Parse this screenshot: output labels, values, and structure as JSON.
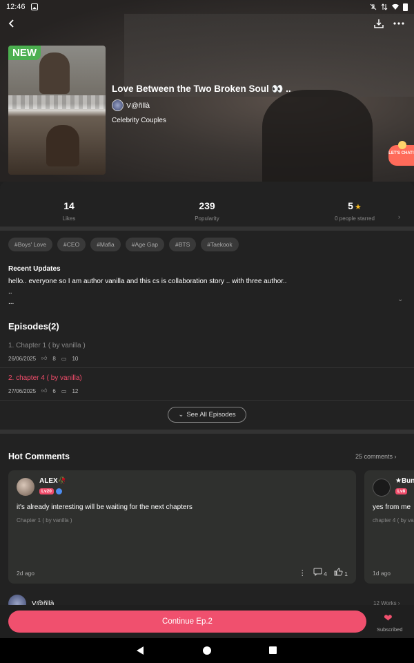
{
  "status_bar": {
    "time": "12:46",
    "icons": [
      "image-icon",
      "mute-icon",
      "data-icon",
      "wifi-icon",
      "battery-icon"
    ]
  },
  "header": {
    "back_icon": "back-arrow-icon",
    "download_icon": "download-icon",
    "more_icon": "more-icon"
  },
  "story": {
    "badge": "NEW",
    "title": "Love Between the Two Broken Soul 👀 ..",
    "author": "V@ñllà",
    "genre": "Celebrity Couples",
    "chat_badge": "LET'S CHAT!"
  },
  "stats": {
    "likes_value": "14",
    "likes_label": "Likes",
    "popularity_value": "239",
    "popularity_label": "Popularity",
    "rating_value": "5",
    "rating_label": "0 people starred"
  },
  "tags": [
    "#Boys' Love",
    "#CEO",
    "#Mafia",
    "#Age Gap",
    "#BTS",
    "#Taekook"
  ],
  "recent_updates": {
    "title": "Recent Updates",
    "text": "hello.. everyone so I am author vanilla and this cs is collaboration story .. with three author..\n..\n..."
  },
  "episodes": {
    "header": "Episodes(2)",
    "items": [
      {
        "title": "1. Chapter 1 ( by vanilla )",
        "date": "26/06/2025",
        "likes": "8",
        "comments": "10"
      },
      {
        "title": "2. chapter 4 ( by vanilla)",
        "date": "27/06/2025",
        "likes": "6",
        "comments": "12"
      }
    ],
    "see_all": "See All Episodes"
  },
  "hot_comments": {
    "header": "Hot Comments",
    "count": "25 comments",
    "comments": [
      {
        "name": "ALEX🥀",
        "level": "Lv20",
        "text": "it's already interesting will be waiting for the next chapters",
        "chapter": "Chapter 1 ( by vanilla )",
        "time": "2d ago",
        "replies": "4",
        "likes": "1"
      },
      {
        "name": "★Bun",
        "level": "Lv8",
        "text": "yes from me",
        "chapter": "chapter 4 ( by va",
        "time": "1d ago"
      }
    ]
  },
  "author_row": {
    "name": "V@ñllà",
    "works": "12 Works"
  },
  "bottom": {
    "continue": "Continue Ep.2",
    "subscribed": "Subscribed"
  },
  "colors": {
    "accent": "#f0506e",
    "badge_green": "#4caf50",
    "star": "#f5b81e"
  }
}
